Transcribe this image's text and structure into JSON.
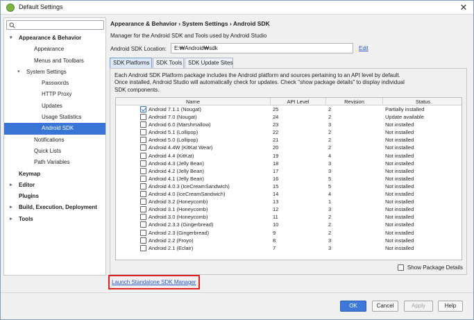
{
  "window": {
    "title": "Default Settings",
    "close_glyph": "✕"
  },
  "search": {
    "placeholder": ""
  },
  "tree": [
    {
      "label": "Appearance & Behavior",
      "indent": 0,
      "arrow": "▾",
      "bold": true,
      "selected": false
    },
    {
      "label": "Appearance",
      "indent": 2,
      "arrow": "",
      "bold": false,
      "selected": false
    },
    {
      "label": "Menus and Toolbars",
      "indent": 2,
      "arrow": "",
      "bold": false,
      "selected": false
    },
    {
      "label": "System Settings",
      "indent": 1,
      "arrow": "▾",
      "bold": false,
      "selected": false
    },
    {
      "label": "Passwords",
      "indent": 3,
      "arrow": "",
      "bold": false,
      "selected": false
    },
    {
      "label": "HTTP Proxy",
      "indent": 3,
      "arrow": "",
      "bold": false,
      "selected": false
    },
    {
      "label": "Updates",
      "indent": 3,
      "arrow": "",
      "bold": false,
      "selected": false
    },
    {
      "label": "Usage Statistics",
      "indent": 3,
      "arrow": "",
      "bold": false,
      "selected": false
    },
    {
      "label": "Android SDK",
      "indent": 3,
      "arrow": "",
      "bold": false,
      "selected": true
    },
    {
      "label": "Notifications",
      "indent": 2,
      "arrow": "",
      "bold": false,
      "selected": false
    },
    {
      "label": "Quick Lists",
      "indent": 2,
      "arrow": "",
      "bold": false,
      "selected": false
    },
    {
      "label": "Path Variables",
      "indent": 2,
      "arrow": "",
      "bold": false,
      "selected": false
    },
    {
      "label": "Keymap",
      "indent": 0,
      "arrow": "",
      "bold": true,
      "selected": false
    },
    {
      "label": "Editor",
      "indent": 0,
      "arrow": "▸",
      "bold": true,
      "selected": false
    },
    {
      "label": "Plugins",
      "indent": 0,
      "arrow": "",
      "bold": true,
      "selected": false
    },
    {
      "label": "Build, Execution, Deployment",
      "indent": 0,
      "arrow": "▸",
      "bold": true,
      "selected": false
    },
    {
      "label": "Tools",
      "indent": 0,
      "arrow": "▸",
      "bold": true,
      "selected": false
    }
  ],
  "header": {
    "breadcrumb": "Appearance & Behavior › System Settings › Android SDK",
    "description": "Manager for the Android SDK and Tools used by Android Studio",
    "location_label": "Android SDK Location:",
    "location_value": "E:₩Android₩sdk",
    "edit_label": "Edit"
  },
  "tabs": [
    "SDK Platforms",
    "SDK Tools",
    "SDK Update Sites"
  ],
  "panel": {
    "description": "Each Android SDK Platform package includes the Android platform and sources pertaining to an API level by default. Once installed, Android Studio will automatically check for updates. Check \"show package details\" to display individual SDK components."
  },
  "table": {
    "columns": [
      "Name",
      "API Level",
      "Revision",
      "Status"
    ],
    "rows": [
      {
        "checked": true,
        "name": "Android 7.1.1 (Nougat)",
        "api": "25",
        "rev": "2",
        "status": "Partially installed"
      },
      {
        "checked": false,
        "name": "Android 7.0 (Nougat)",
        "api": "24",
        "rev": "2",
        "status": "Update available"
      },
      {
        "checked": false,
        "name": "Android 6.0 (Marshmallow)",
        "api": "23",
        "rev": "3",
        "status": "Not installed"
      },
      {
        "checked": false,
        "name": "Android 5.1 (Lollipop)",
        "api": "22",
        "rev": "2",
        "status": "Not installed"
      },
      {
        "checked": false,
        "name": "Android 5.0 (Lollipop)",
        "api": "21",
        "rev": "2",
        "status": "Not installed"
      },
      {
        "checked": false,
        "name": "Android 4.4W (KitKat Wear)",
        "api": "20",
        "rev": "2",
        "status": "Not installed"
      },
      {
        "checked": false,
        "name": "Android 4.4 (KitKat)",
        "api": "19",
        "rev": "4",
        "status": "Not installed"
      },
      {
        "checked": false,
        "name": "Android 4.3 (Jelly Bean)",
        "api": "18",
        "rev": "3",
        "status": "Not installed"
      },
      {
        "checked": false,
        "name": "Android 4.2 (Jelly Bean)",
        "api": "17",
        "rev": "3",
        "status": "Not installed"
      },
      {
        "checked": false,
        "name": "Android 4.1 (Jelly Bean)",
        "api": "16",
        "rev": "5",
        "status": "Not installed"
      },
      {
        "checked": false,
        "name": "Android 4.0.3 (IceCreamSandwich)",
        "api": "15",
        "rev": "5",
        "status": "Not installed"
      },
      {
        "checked": false,
        "name": "Android 4.0 (IceCreamSandwich)",
        "api": "14",
        "rev": "4",
        "status": "Not installed"
      },
      {
        "checked": false,
        "name": "Android 3.2 (Honeycomb)",
        "api": "13",
        "rev": "1",
        "status": "Not installed"
      },
      {
        "checked": false,
        "name": "Android 3.1 (Honeycomb)",
        "api": "12",
        "rev": "3",
        "status": "Not installed"
      },
      {
        "checked": false,
        "name": "Android 3.0 (Honeycomb)",
        "api": "11",
        "rev": "2",
        "status": "Not installed"
      },
      {
        "checked": false,
        "name": "Android 2.3.3 (Gingerbread)",
        "api": "10",
        "rev": "2",
        "status": "Not installed"
      },
      {
        "checked": false,
        "name": "Android 2.3 (Gingerbread)",
        "api": "9",
        "rev": "2",
        "status": "Not installed"
      },
      {
        "checked": false,
        "name": "Android 2.2 (Froyo)",
        "api": "8",
        "rev": "3",
        "status": "Not installed"
      },
      {
        "checked": false,
        "name": "Android 2.1 (Eclair)",
        "api": "7",
        "rev": "3",
        "status": "Not installed"
      }
    ]
  },
  "show_package_details": {
    "label": "Show Package Details",
    "checked": false
  },
  "launch_link": "Launch Standalone SDK Manager",
  "buttons": {
    "ok": "OK",
    "cancel": "Cancel",
    "apply": "Apply",
    "help": "Help"
  },
  "colors": {
    "selection": "#3875d7",
    "primary_button": "#3d78d8",
    "link": "#2a56c6",
    "highlight_box": "#e02020"
  }
}
